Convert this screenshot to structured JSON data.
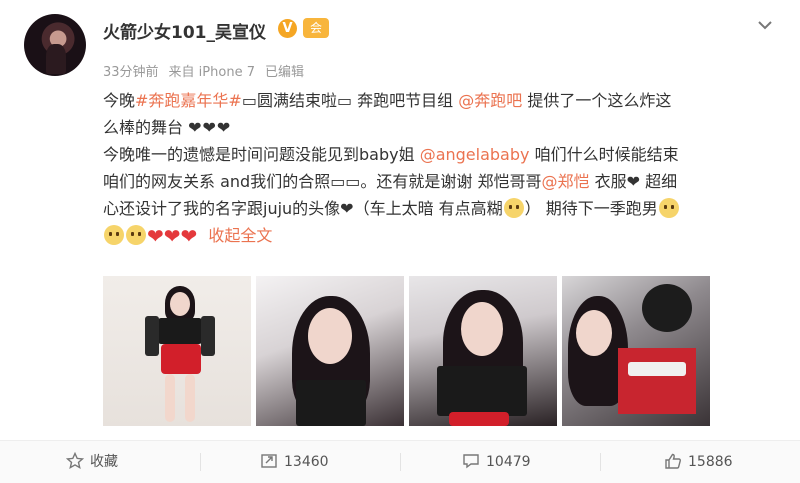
{
  "user": {
    "name": "火箭少女101_吴宣仪",
    "v_badge": "V",
    "vip_badge": "会"
  },
  "meta": {
    "time": "33分钟前",
    "source": "来自 iPhone 7",
    "edited": "已编辑"
  },
  "post": {
    "l1_a": "今晚",
    "l1_tag": "#奔跑嘉年华#",
    "l1_b": "▭圆满结束啦▭ 奔跑吧节目组",
    "l1_mention": "@奔跑吧",
    "l1_c": "提供了一个这么炸这",
    "l2_a": "么棒的舞台",
    "l2_hearts": "❤❤❤",
    "l3_a": "今晚唯一的遗憾是时间问题没能见到baby姐",
    "l3_mention": "@angelababy",
    "l3_b": "咱们什么时候能结束",
    "l4_a": "咱们的网友关系 and我们的合照▭▭。还有就是谢谢 郑恺哥哥",
    "l4_mention": "@郑恺",
    "l4_b": "衣服❤ 超细",
    "l5_a": "心还设计了我的名字跟juju的头像❤（车上太暗 有点高糊",
    "l5_b": "） 期待下一季跑男",
    "l6_collapse": "收起全文"
  },
  "actions": {
    "favorite": "收藏",
    "repost": "13460",
    "comment": "10479",
    "like": "15886"
  },
  "colors": {
    "link": "#eb7350",
    "heart": "#e4393c",
    "badge": "#f5a623"
  }
}
